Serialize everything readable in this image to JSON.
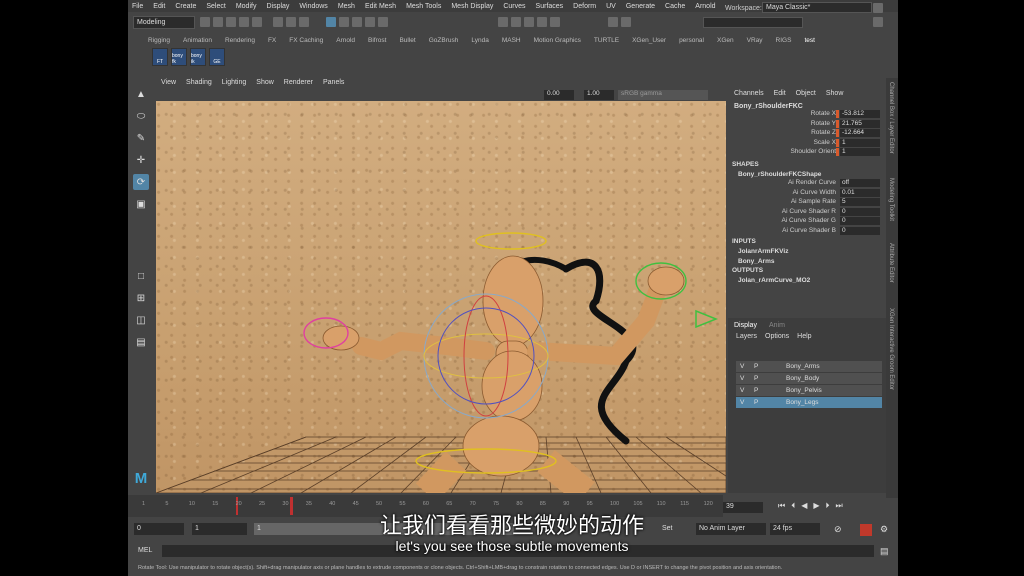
{
  "menubar": [
    "File",
    "Edit",
    "Create",
    "Select",
    "Modify",
    "Display",
    "Windows",
    "Mesh",
    "Edit Mesh",
    "Mesh Tools",
    "Mesh Display",
    "Curves",
    "Surfaces",
    "Deform",
    "UV",
    "Generate",
    "Cache",
    "Arnold"
  ],
  "workspace": {
    "label": "Workspace:",
    "value": "Maya Classic*"
  },
  "mode_selector": "Modeling",
  "shelf_tabs": [
    "Rigging",
    "Animation",
    "Rendering",
    "FX",
    "FX Caching",
    "Arnold",
    "Bifrost",
    "Bullet",
    "GoZBrush",
    "Lynda",
    "MASH",
    "Motion Graphics",
    "TURTLE",
    "XGen_User",
    "personal",
    "XGen",
    "VRay",
    "RIGS",
    "test"
  ],
  "shelf_buttons": [
    "FT",
    "bony fk",
    "bony ik",
    "GE"
  ],
  "panel_menu": [
    "View",
    "Shading",
    "Lighting",
    "Show",
    "Renderer",
    "Panels"
  ],
  "panel_toolbar": {
    "value1": "0.00",
    "value2": "1.00",
    "color_space": "sRGB gamma"
  },
  "channel_box": {
    "menu": [
      "Channels",
      "Edit",
      "Object",
      "Show"
    ],
    "node": "Bony_rShoulderFKC",
    "attributes": [
      {
        "label": "Rotate X",
        "value": "-53.812"
      },
      {
        "label": "Rotate Y",
        "value": "21.765"
      },
      {
        "label": "Rotate Z",
        "value": "-12.664"
      },
      {
        "label": "Scale X",
        "value": "1"
      },
      {
        "label": "Shoulder Orient",
        "value": "1"
      }
    ],
    "shapes_header": "SHAPES",
    "shape_node": "Bony_rShoulderFKCShape",
    "shape_attributes": [
      {
        "label": "Ai Render Curve",
        "value": "off"
      },
      {
        "label": "Ai Curve Width",
        "value": "0.01"
      },
      {
        "label": "Ai Sample Rate",
        "value": "5"
      },
      {
        "label": "Ai Curve Shader R",
        "value": "0"
      },
      {
        "label": "Ai Curve Shader G",
        "value": "0"
      },
      {
        "label": "Ai Curve Shader B",
        "value": "0"
      }
    ],
    "inputs_header": "INPUTS",
    "inputs": [
      "JolanrArmFKViz",
      "Bony_Arms"
    ],
    "outputs_header": "OUTPUTS",
    "outputs": [
      "Jolan_rArmCurve_MO2"
    ]
  },
  "layer_editor": {
    "tabs": [
      "Display",
      "Anim"
    ],
    "menu": [
      "Layers",
      "Options",
      "Help"
    ],
    "layers": [
      {
        "v": "V",
        "p": "P",
        "name": "Bony_Arms",
        "selected": false
      },
      {
        "v": "V",
        "p": "P",
        "name": "Bony_Body",
        "selected": false
      },
      {
        "v": "V",
        "p": "P",
        "name": "Bony_Pelvis",
        "selected": false
      },
      {
        "v": "V",
        "p": "P",
        "name": "Bony_Legs",
        "selected": true
      }
    ]
  },
  "right_strip": [
    "Channel Box / Layer Editor",
    "Modeling Toolkit",
    "Attribute Editor",
    "XGen Interactive Groom Editor"
  ],
  "timeline": {
    "ticks": [
      "1",
      "5",
      "10",
      "15",
      "20",
      "25",
      "30",
      "35",
      "40",
      "45",
      "50",
      "55",
      "60",
      "65",
      "70",
      "75",
      "80",
      "85",
      "90",
      "95",
      "100",
      "105",
      "110",
      "115",
      "120"
    ],
    "current_frame": "39"
  },
  "range": {
    "start": "0",
    "min": "1",
    "min2": "1",
    "set_label": "Set",
    "anim_layer": "No Anim Layer",
    "fps": "24 fps"
  },
  "mel": {
    "label": "MEL"
  },
  "help_line": "Rotate Tool: Use manipulator to rotate object(s). Shift+drag manipulator axis or plane handles to extrude components or clone objects. Ctrl+Shift+LMB+drag to constrain rotation to connected edges. Use D or INSERT to change the pivot position and axis orientation.",
  "subtitles": {
    "cn": "让我们看看那些微妙的动作",
    "en": "let's you see those subtle movements"
  },
  "logo": "M"
}
